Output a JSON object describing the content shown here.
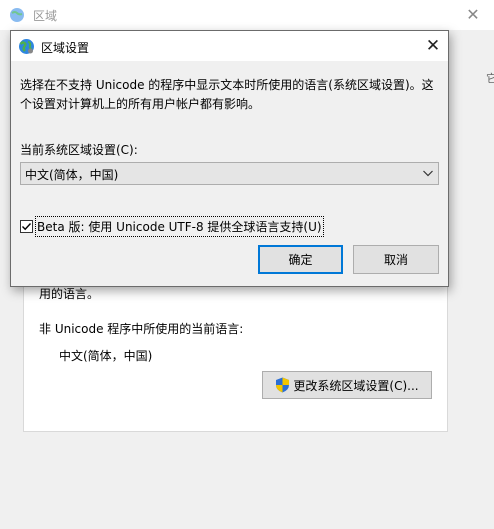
{
  "background_window": {
    "title": "区域",
    "close_glyph": "✕",
    "right_edge_char": "它",
    "text_partial": "用的语言。",
    "non_unicode_label": "非 Unicode 程序中所使用的当前语言:",
    "current_language": "中文(简体，中国)",
    "change_button_label": "更改系统区域设置(C)...",
    "change_button_icon": "uac-shield-icon"
  },
  "dialog": {
    "title": "区域设置",
    "close_glyph": "✕",
    "description": "选择在不支持 Unicode 的程序中显示文本时所使用的语言(系统区域设置)。这个设置对计算机上的所有用户帐户都有影响。",
    "current_locale_label": "当前系统区域设置(C):",
    "locale_select_value": "中文(简体，中国)",
    "beta_checkbox_label": "Beta 版: 使用 Unicode UTF-8 提供全球语言支持(U)",
    "beta_checkbox_checked": true,
    "ok_label": "确定",
    "cancel_label": "取消"
  },
  "colors": {
    "accent_focus": "#0078d7",
    "button_face": "#e1e1e1",
    "window_bg": "#f0f0f0"
  }
}
